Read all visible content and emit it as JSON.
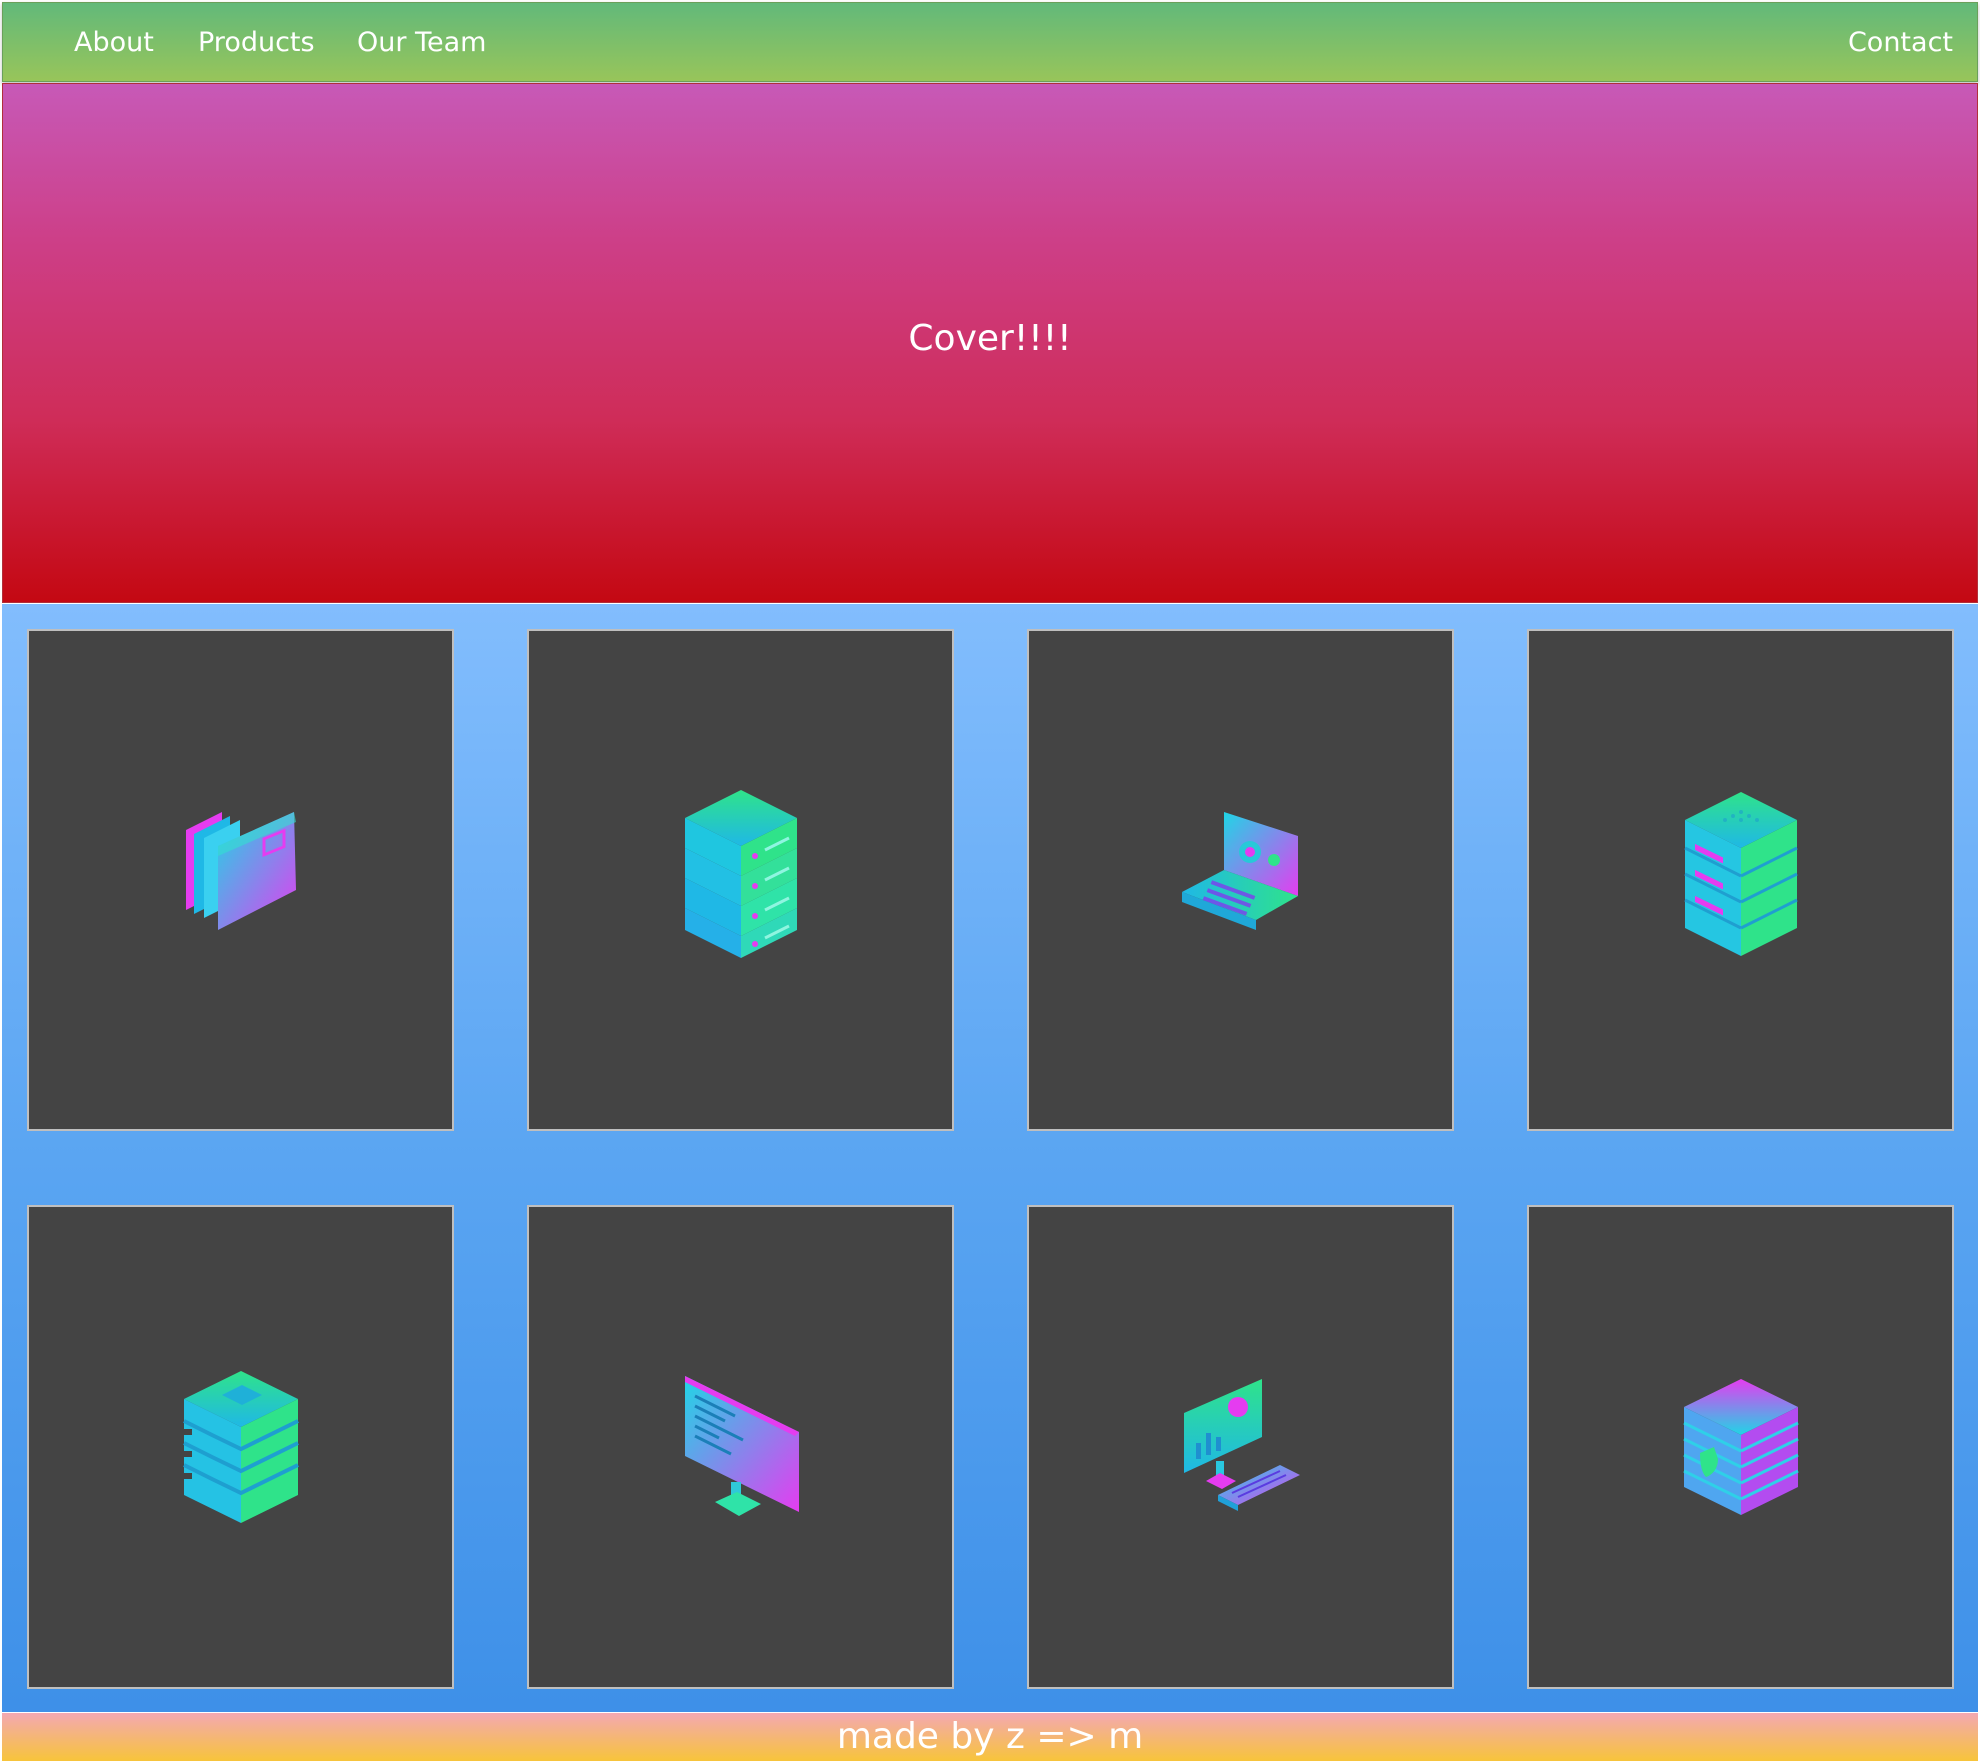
{
  "nav": {
    "about": "About",
    "products": "Products",
    "our_team": "Our Team",
    "contact": "Contact"
  },
  "hero": {
    "title": "Cover!!!!"
  },
  "products": {
    "items": [
      {
        "icon": "folders-icon"
      },
      {
        "icon": "server-stack-icon"
      },
      {
        "icon": "laptop-settings-icon"
      },
      {
        "icon": "server-rack-icon"
      },
      {
        "icon": "database-icon"
      },
      {
        "icon": "code-monitor-icon"
      },
      {
        "icon": "analytics-workstation-icon"
      },
      {
        "icon": "security-server-icon"
      }
    ]
  },
  "footer": {
    "text": "made by z => m"
  },
  "colors": {
    "nav_top": "#62b97a",
    "nav_bottom": "#98c55a",
    "hero_top": "#c759b7",
    "hero_bottom": "#c40812",
    "products_top": "#82bdfd",
    "products_bottom": "#3e90e8",
    "card": "#444444",
    "footer_top": "#f3a8b2",
    "footer_bottom": "#f7c43a",
    "icon_cyan": "#1fd6e6",
    "icon_green": "#2fe38a",
    "icon_magenta": "#e53cf0"
  }
}
